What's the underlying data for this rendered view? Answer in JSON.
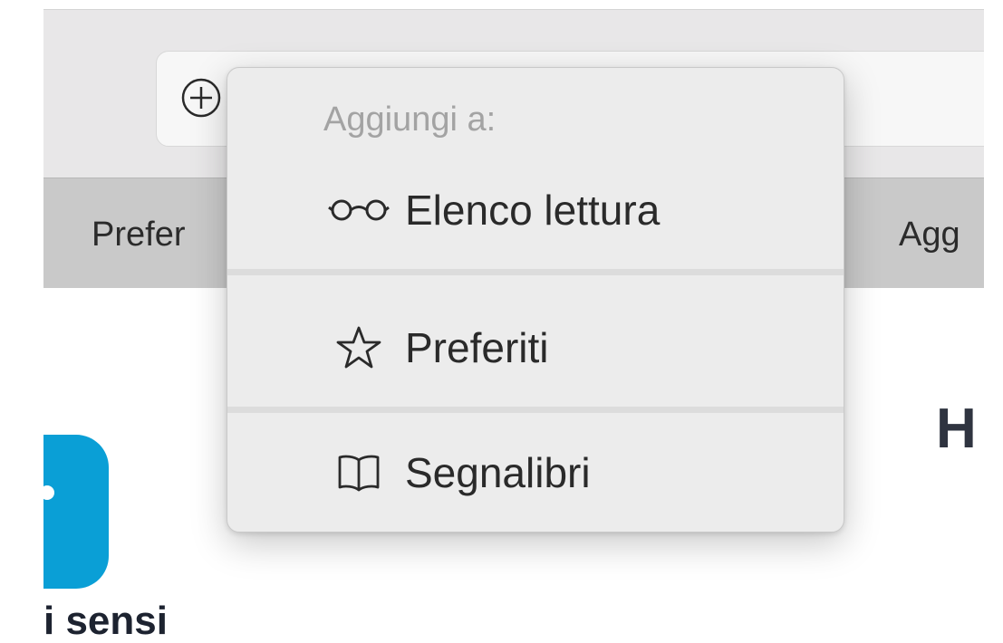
{
  "favorites_bar": {
    "left_item_label": "Prefer",
    "right_item_label": "Agg"
  },
  "page": {
    "heading_fragment": "H",
    "bottom_text_fragment": "i sensi"
  },
  "popup": {
    "header": "Aggiungi a:",
    "items": [
      {
        "label": "Elenco lettura",
        "icon": "reading-list-glasses-icon"
      },
      {
        "label": "Preferiti",
        "icon": "star-outline-icon"
      },
      {
        "label": "Segnalibri",
        "icon": "open-book-icon"
      }
    ]
  },
  "toolbar": {
    "add_button_icon": "plus-circle-icon"
  },
  "colors": {
    "toolbar_bg": "#e8e7e8",
    "favorites_bar_bg": "#c9c9c9",
    "accent_blue": "#4a8ed8",
    "logo_blue": "#0a9fd6",
    "popup_bg": "#ececec",
    "header_text": "#a3a3a3"
  }
}
